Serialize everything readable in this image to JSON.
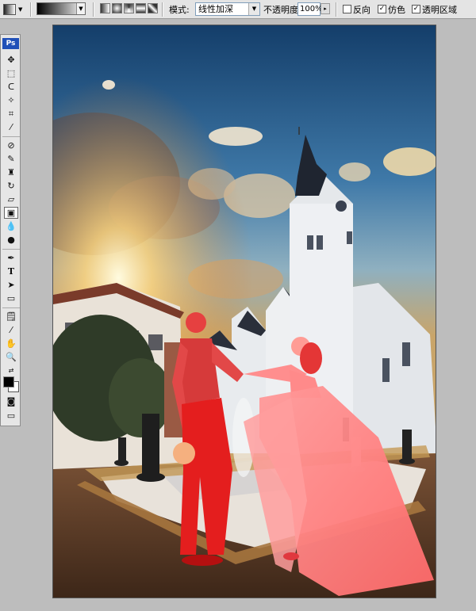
{
  "options_bar": {
    "mode_label": "模式:",
    "mode_value": "线性加深",
    "opacity_label": "不透明度:",
    "opacity_value": "100%",
    "reverse_label": "反向",
    "reverse_checked": false,
    "dither_label": "仿色",
    "dither_checked": true,
    "transparency_label": "透明区域",
    "transparency_checked": true
  },
  "toolbox": {
    "logo": "Ps",
    "foreground_color": "#000000",
    "background_color": "#ffffff"
  },
  "document": {
    "description_icon": "wedding-photo"
  }
}
